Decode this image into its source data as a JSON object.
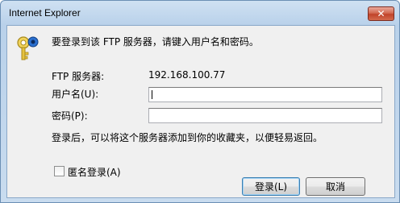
{
  "window": {
    "title": "Internet Explorer",
    "close_glyph": "✕"
  },
  "icon": "key-icon",
  "prompt": "要登录到该 FTP 服务器，请键入用户名和密码。",
  "server": {
    "label": "FTP 服务器:",
    "value": "192.168.100.77"
  },
  "username": {
    "label": "用户名(U):",
    "value": ""
  },
  "password": {
    "label": "密码(P):",
    "value": ""
  },
  "note": "登录后，可以将这个服务器添加到你的收藏夹，以便轻易返回。",
  "anonymous": {
    "label": "匿名登录(A)",
    "checked": false
  },
  "buttons": {
    "login": "登录(L)",
    "cancel": "取消"
  }
}
